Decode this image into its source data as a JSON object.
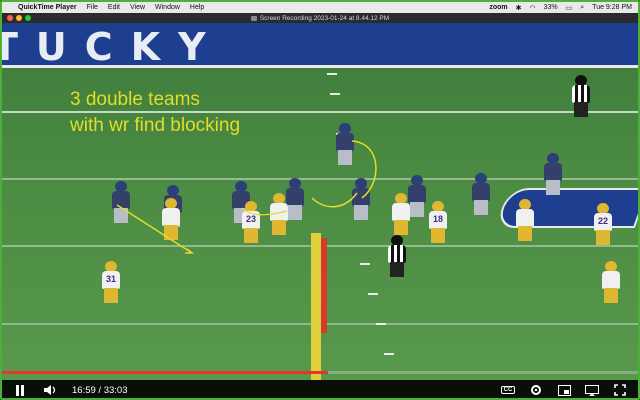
{
  "menubar": {
    "app_name": "QuickTime Player",
    "menus": [
      "File",
      "Edit",
      "View",
      "Window",
      "Help"
    ],
    "zoom_label": "zoom",
    "battery": "33%",
    "clock": "Tue 9:28 PM"
  },
  "window": {
    "title": "Screen Recording 2023-01-24 at 8.44.12 PM"
  },
  "video": {
    "stands_text": "TUCKY",
    "annotation_line1": "3 double teams",
    "annotation_line2": "with wr find blocking",
    "jersey_numbers": [
      "23",
      "18",
      "22",
      "31"
    ],
    "annotation_color": "#e3dc2a"
  },
  "controls": {
    "current_time": "16:59",
    "total_time": "33:03",
    "time_separator": "/",
    "progress_fraction": 0.513,
    "icons": [
      "pause-icon",
      "volume-icon",
      "captions-icon",
      "settings-icon",
      "miniplayer-icon",
      "cast-icon",
      "fullscreen-icon"
    ],
    "cc_label": "CC"
  },
  "colors": {
    "frame_border": "#4caf37",
    "progress_red": "#e5362b",
    "kentucky_blue": "#1e3f8f",
    "lsu_gold": "#e0b730"
  }
}
